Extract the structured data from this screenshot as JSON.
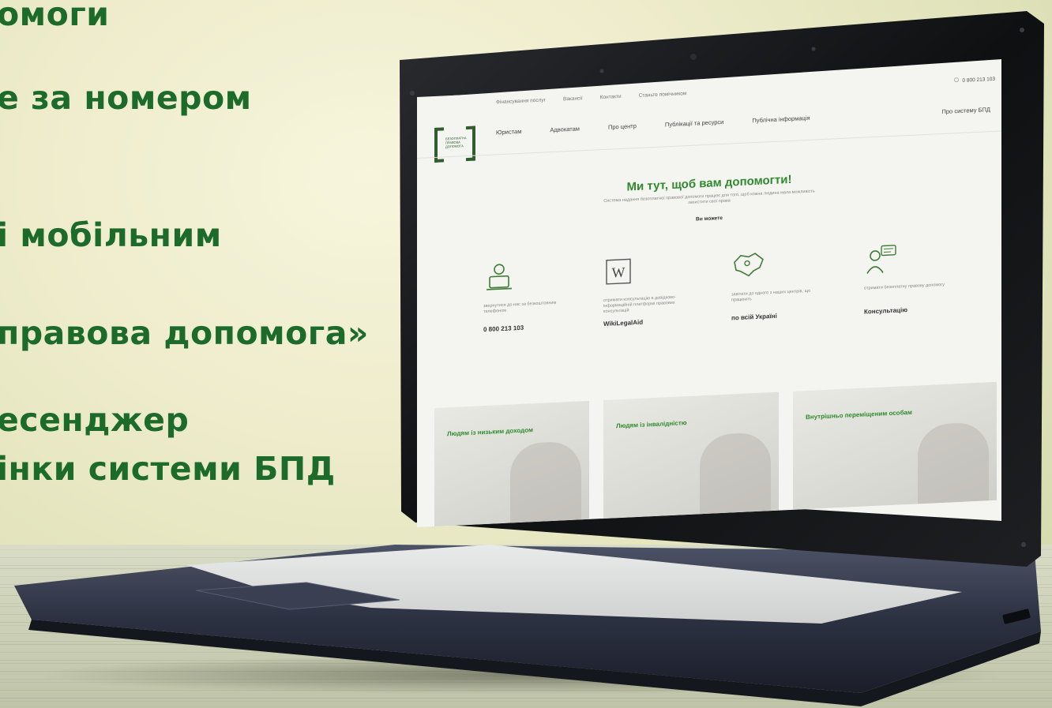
{
  "promo": {
    "lines": [
      "омоги",
      "е за номером",
      "і мобільним",
      "правова допомога»",
      "есенджер",
      "інки системи БПД"
    ]
  },
  "website": {
    "topbar": {
      "links": [
        "Фінансування послуг",
        "Вакансії",
        "Контакти",
        "Станьте помічником"
      ],
      "phone": "0 800 213 103"
    },
    "nav": {
      "items": [
        "Юристам",
        "Адвокатам",
        "Про центр",
        "Публікації та ресурси",
        "Публічна інформація"
      ],
      "about": "Про систему БПД"
    },
    "logo_text": "БЕЗОПЛАТНА ПРАВОВА ДОПОМОГА",
    "hero": {
      "title": "Ми тут, щоб вам допомогти!",
      "subtitle": "Система надання безоплатної правової допомоги працює для того, щоб кожна людина мала можливість захистити свої права",
      "you_can": "Ви можете"
    },
    "features": [
      {
        "icon": "phone-operator-icon",
        "text": "звернутися до нас за безкоштовним телефоном",
        "value": "0 800 213 103"
      },
      {
        "icon": "wiki-icon",
        "text": "отримати консультацію в довідково-інформаційній платформі правових консультацій",
        "value": "WikiLegalAid"
      },
      {
        "icon": "ukraine-map-icon",
        "text": "завітати до одного з наших центрів, що працюють",
        "value": "по всій Україні"
      },
      {
        "icon": "consultant-chat-icon",
        "text": "отримати безоплатну правову допомогу",
        "value": "Консультацію"
      }
    ],
    "cards": [
      "Людям із низьким доходом",
      "Людям із інвалідністю",
      "Внутрішньо переміщеним особам"
    ]
  },
  "colors": {
    "promo_green": "#1d6b2a",
    "site_green": "#2f8a2e"
  }
}
